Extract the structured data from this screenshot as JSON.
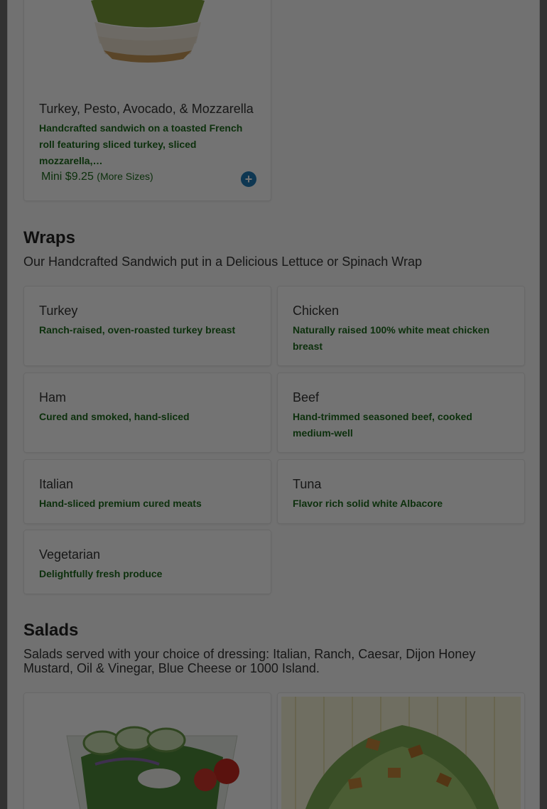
{
  "sandwich_card": {
    "title": "Turkey, Pesto, Avocado, & Mozzarella",
    "description": "Handcrafted sandwich on a toasted French roll featuring sliced turkey, sliced mozzarella,…",
    "size_label": "Mini",
    "price": "$9.25",
    "more_sizes": "(More Sizes)",
    "add_icon": "plus-circle-icon"
  },
  "wraps": {
    "title": "Wraps",
    "subtitle": "Our Handcrafted Sandwich put in a Delicious Lettuce or Spinach Wrap",
    "items": [
      {
        "name": "Turkey",
        "desc": "Ranch-raised, oven-roasted turkey breast"
      },
      {
        "name": "Chicken",
        "desc": "Naturally raised 100% white meat chicken breast"
      },
      {
        "name": "Ham",
        "desc": "Cured and smoked, hand-sliced"
      },
      {
        "name": "Beef",
        "desc": "Hand-trimmed seasoned beef, cooked medium-well"
      },
      {
        "name": "Italian",
        "desc": "Hand-sliced premium cured meats"
      },
      {
        "name": "Tuna",
        "desc": "Flavor rich solid white Albacore"
      },
      {
        "name": "Vegetarian",
        "desc": "Delightfully fresh produce"
      }
    ]
  },
  "salads": {
    "title": "Salads",
    "subtitle": "Salads served with your choice of dressing: Italian, Ranch, Caesar, Dijon Honey Mustard, Oil & Vinegar, Blue Cheese or 1000 Island."
  },
  "colors": {
    "accent_green": "#1d6a1d",
    "add_button": "#1f7bb5",
    "overlay": "rgba(0,0,0,0.55)"
  }
}
